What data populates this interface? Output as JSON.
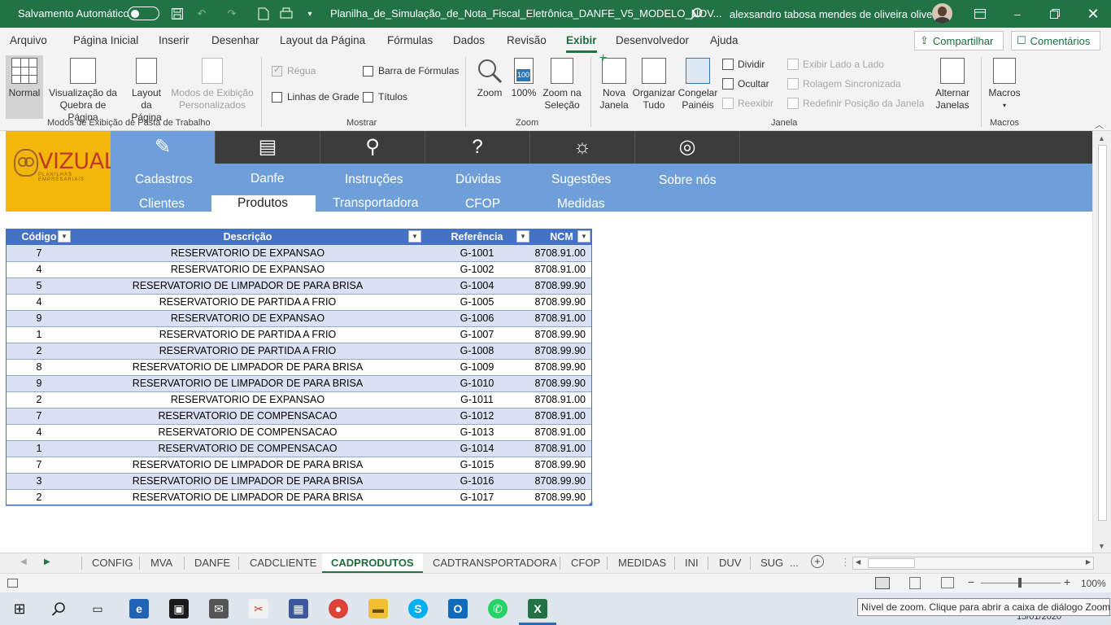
{
  "titlebar": {
    "autosave_label": "Salvamento Automático",
    "filename": "Planilha_de_Simulação_de_Nota_Fiscal_Eletrônica_DANFE_V5_MODELO_NOV...",
    "user": "alexsandro tabosa mendes de oliveira oliveira",
    "bg_color": "#217346"
  },
  "menu": {
    "items": [
      "Arquivo",
      "Página Inicial",
      "Inserir",
      "Desenhar",
      "Layout da Página",
      "Fórmulas",
      "Dados",
      "Revisão",
      "Exibir",
      "Desenvolvedor",
      "Ajuda"
    ],
    "active": "Exibir",
    "share_label": "Compartilhar",
    "comments_label": "Comentários"
  },
  "ribbon": {
    "views": {
      "normal": "Normal",
      "page_break_1": "Visualização da",
      "page_break_2": "Quebra de Página",
      "page_layout_1": "Layout",
      "page_layout_2": "da Página",
      "custom_1": "Modos de Exibição",
      "custom_2": "Personalizados",
      "group": "Modos de Exibição de Pasta de Trabalho"
    },
    "show": {
      "ruler": "Régua",
      "formula_bar": "Barra de Fórmulas",
      "gridlines": "Linhas de Grade",
      "headings": "Títulos",
      "group": "Mostrar"
    },
    "zoom": {
      "zoom": "Zoom",
      "hundred": "100%",
      "sel_1": "Zoom na",
      "sel_2": "Seleção",
      "group": "Zoom",
      "icon_text": "100"
    },
    "window": {
      "new_1": "Nova",
      "new_2": "Janela",
      "arrange_1": "Organizar",
      "arrange_2": "Tudo",
      "freeze_1": "Congelar",
      "freeze_2": "Painéis",
      "split": "Dividir",
      "hide": "Ocultar",
      "unhide": "Reexibir",
      "side_by_side": "Exibir Lado a Lado",
      "sync_scroll": "Rolagem Sincronizada",
      "reset_pos": "Redefinir Posição da Janela",
      "switch_1": "Alternar",
      "switch_2": "Janelas",
      "group": "Janela"
    },
    "macros": {
      "label": "Macros",
      "group": "Macros"
    }
  },
  "nav": {
    "logo_text": "VIZUAL",
    "logo_sub": "PLANILHAS EMPRESARIAIS",
    "main": [
      "Cadastros",
      "Danfe",
      "Instruções",
      "Dúvidas",
      "Sugestões",
      "Sobre nós"
    ],
    "sub": [
      "Clientes",
      "Produtos",
      "Transportadora",
      "CFOP",
      "Medidas"
    ],
    "active_sub": "Produtos",
    "icons": [
      "pencil-icon",
      "document-icon",
      "teacher-icon",
      "people-question-icon",
      "lightbulb-icon",
      "owl-icon"
    ]
  },
  "table": {
    "headers": [
      "Código",
      "Descrição",
      "Referência",
      "NCM"
    ],
    "rows": [
      [
        "7",
        "RESERVATORIO DE EXPANSAO",
        "G-1001",
        "8708.91.00"
      ],
      [
        "4",
        "RESERVATORIO DE EXPANSAO",
        "G-1002",
        "8708.91.00"
      ],
      [
        "5",
        "RESERVATORIO DE LIMPADOR DE PARA BRISA",
        "G-1004",
        "8708.99.90"
      ],
      [
        "4",
        "RESERVATORIO DE PARTIDA A FRIO",
        "G-1005",
        "8708.99.90"
      ],
      [
        "9",
        "RESERVATORIO DE EXPANSAO",
        "G-1006",
        "8708.91.00"
      ],
      [
        "1",
        "RESERVATORIO DE PARTIDA A FRIO",
        "G-1007",
        "8708.99.90"
      ],
      [
        "2",
        "RESERVATORIO DE PARTIDA A FRIO",
        "G-1008",
        "8708.99.90"
      ],
      [
        "8",
        "RESERVATORIO DE LIMPADOR DE PARA BRISA",
        "G-1009",
        "8708.99.90"
      ],
      [
        "9",
        "RESERVATORIO DE LIMPADOR DE PARA BRISA",
        "G-1010",
        "8708.99.90"
      ],
      [
        "2",
        "RESERVATORIO DE EXPANSAO",
        "G-1011",
        "8708.91.00"
      ],
      [
        "7",
        "RESERVATORIO DE COMPENSACAO",
        "G-1012",
        "8708.91.00"
      ],
      [
        "4",
        "RESERVATORIO DE COMPENSACAO",
        "G-1013",
        "8708.91.00"
      ],
      [
        "1",
        "RESERVATORIO DE COMPENSACAO",
        "G-1014",
        "8708.91.00"
      ],
      [
        "7",
        "RESERVATORIO DE LIMPADOR DE PARA BRISA",
        "G-1015",
        "8708.99.90"
      ],
      [
        "3",
        "RESERVATORIO DE LIMPADOR DE PARA BRISA",
        "G-1016",
        "8708.99.90"
      ],
      [
        "2",
        "RESERVATORIO DE LIMPADOR DE PARA BRISA",
        "G-1017",
        "8708.99.90"
      ]
    ],
    "header_color": "#4472c4",
    "band_color": "#d9e1f2"
  },
  "sheet_tabs": {
    "tabs": [
      "CONFIG",
      "MVA",
      "DANFE",
      "CADCLIENTE",
      "CADPRODUTOS",
      "CADTRANSPORTADORA",
      "CFOP",
      "MEDIDAS",
      "INI",
      "DUV",
      "SUG"
    ],
    "active": "CADPRODUTOS",
    "more": "..."
  },
  "status": {
    "zoom_percent": "100%",
    "tooltip": "Nível de zoom. Clique para abrir a caixa de diálogo Zoom.",
    "date": "15/01/2020"
  }
}
